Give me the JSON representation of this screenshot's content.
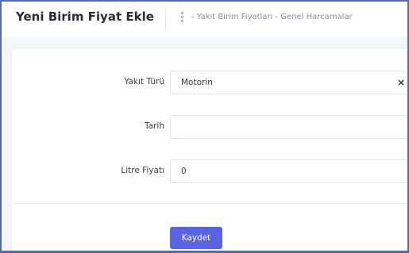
{
  "header": {
    "title": "Yeni Birim Fiyat Ekle",
    "breadcrumb": "- Yakıt Birim Fiyatları - Genel Harcamalar"
  },
  "form": {
    "fuel_type": {
      "label": "Yakıt Türü",
      "value": "Motorin"
    },
    "date": {
      "label": "Tarih",
      "value": ""
    },
    "liter_price": {
      "label": "Litre Fiyatı",
      "value": "0"
    },
    "save_label": "Kaydet"
  },
  "colors": {
    "accent": "#5a63e1",
    "frame_border": "#4e6ea6"
  },
  "icons": {
    "breadcrumb": "dots-vertical-icon",
    "clear": "close-icon",
    "dropdown": "chevron-down-icon"
  }
}
